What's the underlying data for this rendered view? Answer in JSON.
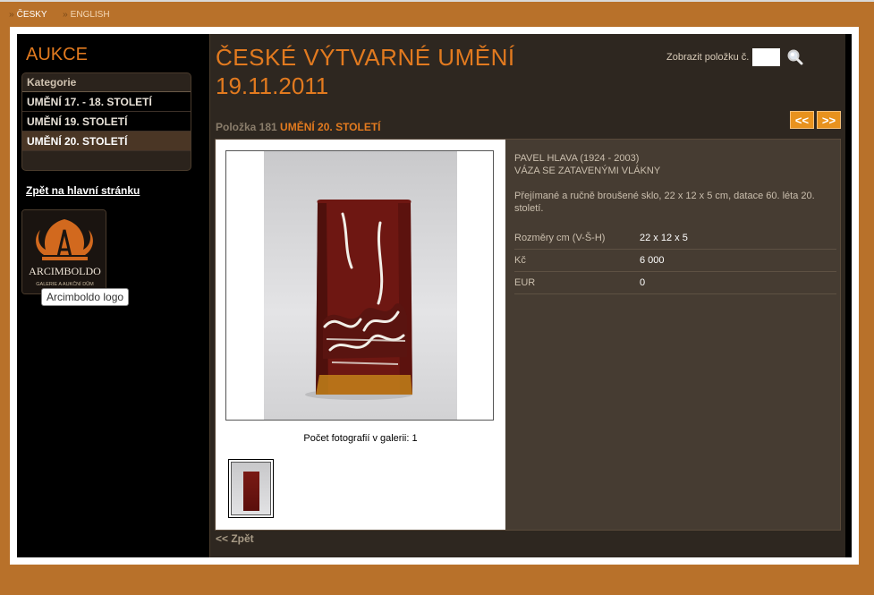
{
  "lang": {
    "czech": "ČESKY",
    "english": "ENGLISH",
    "arrow": "››"
  },
  "sidebar": {
    "title": "AUKCE",
    "category_heading": "Kategorie",
    "items": [
      {
        "label": "UMĚNÍ 17. - 18. STOLETÍ"
      },
      {
        "label": "UMĚNÍ 19. STOLETÍ"
      },
      {
        "label": "UMĚNÍ 20. STOLETÍ",
        "active": true
      }
    ],
    "back_link": "Zpět na hlavní stránku",
    "logo_text": "ARCIMBOLDO",
    "logo_sub": "GALERIE A AUKČNÍ DŮM",
    "tooltip": "Arcimboldo logo"
  },
  "main": {
    "title_line1": "ČESKÉ VÝTVARNÉ UMĚNÍ",
    "title_line2": "19.11.2011",
    "search_label": "Zobrazit položku č.",
    "search_value": "",
    "item_prefix": "Položka 181",
    "item_category": "UMĚNÍ 20. STOLETÍ",
    "prev": "<<",
    "next": ">>",
    "gallery_count": "Počet fotografií v galerii: 1",
    "artist": "PAVEL HLAVA (1924 - 2003)",
    "work_title": "VÁZA SE ZATAVENÝMI VLÁKNY",
    "description": "Přejímané a ručně broušené sklo, 22 x 12 x 5 cm, datace 60. léta 20. století.",
    "attributes": [
      {
        "key": "Rozměry cm (V-Š-H)",
        "value": "22 x 12 x 5"
      },
      {
        "key": "Kč",
        "value": "6 000"
      },
      {
        "key": "EUR",
        "value": "0"
      }
    ],
    "back": "<< Zpět"
  },
  "colors": {
    "accent": "#e27a1f",
    "frame": "#b8712a",
    "panel": "#2e2720",
    "button": "#e8921e"
  },
  "icons": {
    "search": "magnifier-icon"
  }
}
